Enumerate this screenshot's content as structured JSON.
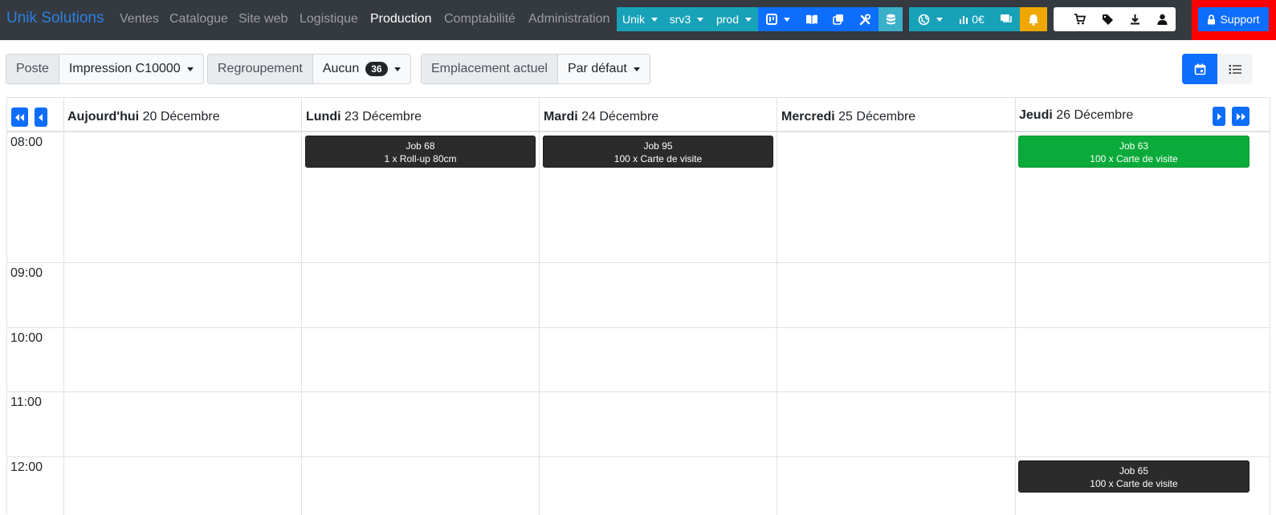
{
  "navbar": {
    "brand": "Unik Solutions",
    "links": [
      "Ventes",
      "Catalogue",
      "Site web",
      "Logistique",
      "Production",
      "Comptabilité",
      "Administration"
    ],
    "company_select": "Unik",
    "server_select": "srv3",
    "env_select": "prod",
    "cart_amount": "0€",
    "support_label": "Support"
  },
  "filters": {
    "poste_label": "Poste",
    "poste_value": "Impression C10000",
    "group_label": "Regroupement",
    "group_value": "Aucun",
    "group_count": "36",
    "location_label": "Emplacement actuel",
    "location_value": "Par défaut"
  },
  "calendar": {
    "days": [
      {
        "name": "Aujourd'hui",
        "date": "20 Décembre"
      },
      {
        "name": "Lundi",
        "date": "23 Décembre"
      },
      {
        "name": "Mardi",
        "date": "24 Décembre"
      },
      {
        "name": "Mercredi",
        "date": "25 Décembre"
      },
      {
        "name": "Jeudi",
        "date": "26 Décembre"
      }
    ],
    "hours": [
      "08:00",
      "09:00",
      "10:00",
      "11:00",
      "12:00"
    ],
    "events": [
      {
        "title": "Job 68",
        "detail": "1 x Roll-up 80cm",
        "day": "Lundi",
        "time": "08:00",
        "color": "#2b2b2b"
      },
      {
        "title": "Job 95",
        "detail": "100 x Carte de visite",
        "day": "Mardi",
        "time": "08:00",
        "color": "#2b2b2b"
      },
      {
        "title": "Job 63",
        "detail": "100 x Carte de visite",
        "day": "Jeudi",
        "time": "08:00",
        "color": "#0aab3a"
      },
      {
        "title": "Job 65",
        "detail": "100 x Carte de visite",
        "day": "Jeudi",
        "time": "12:00",
        "color": "#2b2b2b"
      }
    ]
  },
  "colors": {
    "navbar_bg": "#343a40",
    "brand": "#2f7fe0",
    "primary": "#0d6efd",
    "info": "#17a2b8",
    "warning": "#f0a800",
    "support_highlight": "#ff0000",
    "event_dark": "#2b2b2b",
    "event_green": "#0aab3a"
  },
  "icons": [
    "book-icon",
    "copy-icon",
    "tools-icon",
    "database-icon",
    "globe-icon",
    "chart-icon",
    "chat-icon",
    "bell-icon",
    "cart-icon",
    "tags-icon",
    "download-icon",
    "user-icon",
    "lock-icon",
    "calendar-icon",
    "list-icon"
  ]
}
